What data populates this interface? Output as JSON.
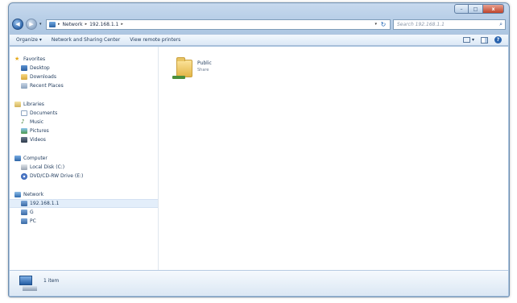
{
  "window": {
    "caption_buttons": {
      "minimize": "–",
      "maximize": "□",
      "close": "x"
    }
  },
  "nav": {
    "back_glyph": "◀",
    "forward_glyph": "▶",
    "dropdown_glyph": "▾"
  },
  "address": {
    "crumbs": [
      "Network",
      "192.168.1.1"
    ],
    "separator": "▸",
    "refresh_glyph": "↻"
  },
  "search": {
    "placeholder": "Search 192.168.1.1",
    "icon_glyph": "⌕"
  },
  "commandbar": {
    "organize": "Organize",
    "organize_drop": "▾",
    "network_sharing": "Network and Sharing Center",
    "view_printers": "View remote printers",
    "views_drop": "▾",
    "help_glyph": "?"
  },
  "sidebar": {
    "favorites": {
      "label": "Favorites",
      "icon_glyph": "★",
      "items": [
        "Desktop",
        "Downloads",
        "Recent Places"
      ]
    },
    "libraries": {
      "label": "Libraries",
      "items": [
        "Documents",
        "Music",
        "Pictures",
        "Videos"
      ],
      "music_glyph": "♪"
    },
    "computer": {
      "label": "Computer",
      "items": [
        "Local Disk (C:)",
        "DVD/CD-RW Drive (E:)"
      ]
    },
    "network": {
      "label": "Network",
      "items": [
        "192.168.1.1",
        "G",
        "PC"
      ]
    }
  },
  "content": {
    "items": [
      {
        "name": "Public",
        "type": "Share"
      }
    ]
  },
  "details": {
    "count_text": "1 item"
  },
  "colors": {
    "frame": "#b6cde6",
    "selected_row": "#e3eefa",
    "text": "#1e395b",
    "close_button": "#c0452c"
  },
  "icons": {
    "favorites": "star-icon",
    "desktop": "desktop-icon",
    "downloads": "downloads-icon",
    "recent": "recent-places-icon",
    "libraries": "libraries-icon",
    "documents": "documents-icon",
    "music": "music-icon",
    "pictures": "pictures-icon",
    "videos": "videos-icon",
    "computer": "computer-icon",
    "local_disk": "hard-disk-icon",
    "dvd": "dvd-drive-icon",
    "network": "network-icon",
    "pc": "computer-network-icon",
    "share": "shared-folder-icon"
  }
}
